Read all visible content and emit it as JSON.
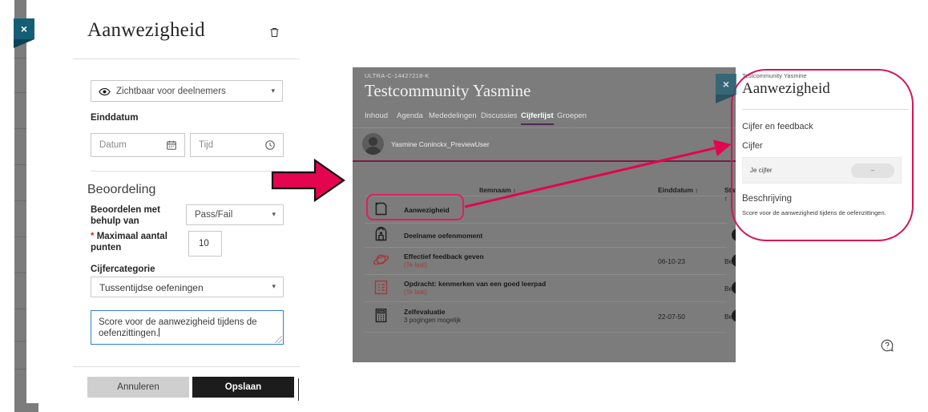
{
  "left_panel": {
    "title": "Aanwezigheid",
    "close_label": "×",
    "delete_icon": "trash-icon",
    "visibility": {
      "icon": "eye-icon",
      "value": "Zichtbaar voor deelnemers",
      "caret": "▾"
    },
    "einddatum": {
      "label": "Einddatum",
      "date_placeholder": "Datum",
      "date_icon": "calendar-icon",
      "time_placeholder": "Tijd",
      "time_icon": "clock-icon"
    },
    "beoordeling": {
      "heading": "Beoordeling",
      "grade_with_label": "Beoordelen met behulp van",
      "grade_with_value": "Pass/Fail",
      "maxpoints_star": "*",
      "maxpoints_label": "Maximaal aantal punten",
      "maxpoints_value": "10",
      "category_label": "Cijfercategorie",
      "category_value": "Tussentijdse oefeningen",
      "description_value": "Score voor de aanwezigheid tijdens de oefenzittingen."
    },
    "footer": {
      "cancel_label": "Annuleren",
      "save_label": "Opslaan"
    }
  },
  "middle_panel": {
    "course_id": "ULTRA-C-14427218-K",
    "course_title": "Testcommunity Yasmine",
    "close_label": "×",
    "tabs": [
      {
        "label": "Inhoud",
        "active": false
      },
      {
        "label": "Agenda",
        "active": false
      },
      {
        "label": "Mededelingen",
        "active": false
      },
      {
        "label": "Discussies",
        "active": false
      },
      {
        "label": "Cijferlijst",
        "active": true
      },
      {
        "label": "Groepen",
        "active": false
      }
    ],
    "user_name": "Yasmine Coninckx_PreviewUser",
    "columns": [
      {
        "label": "Itemnaam",
        "sort": "≡"
      },
      {
        "label": "Einddatum",
        "sort": "≡"
      },
      {
        "label": "Status",
        "sort": "≡"
      }
    ],
    "rows": [
      {
        "icon": "document-icon",
        "name": "Aanwezigheid",
        "sub": "",
        "date": "",
        "status": "",
        "has_pill": false
      },
      {
        "icon": "backpack-icon",
        "name": "Deelname oefenmoment",
        "sub": "",
        "date": "",
        "status": "",
        "has_pill": true
      },
      {
        "icon": "planet-icon",
        "name": "Effectief feedback geven",
        "sub": "(Te laat)",
        "date": "06-10-23",
        "status": "Beoordeeld",
        "has_pill": true
      },
      {
        "icon": "checklist-icon",
        "name": "Opdracht: kenmerken van een goed leerpad",
        "sub": "(Te laat)",
        "date": "",
        "status": "Beoordeeld",
        "has_pill": true
      },
      {
        "icon": "calculator-icon",
        "name": "Zelfevaluatie",
        "sub": "3 pogingen mogelijk",
        "date": "22-07-50",
        "status": "Beoordeeld",
        "has_pill": true
      }
    ]
  },
  "right_panel": {
    "course_title": "Testcommunity Yasmine",
    "title": "Aanwezigheid",
    "close_label": "×",
    "section_grade_feedback": "Cijfer en feedback",
    "section_grade": "Cijfer",
    "grade_box_label": "Je cijfer",
    "grade_box_value": "–",
    "section_description": "Beschrijving",
    "description": "Score voor de aanwezigheid tijdens de oefenzittingen.",
    "help_icon": "help-icon"
  },
  "annotations": {
    "big_arrow": "right-arrow",
    "connector_arrow": "callout-arrow",
    "row_highlight": "highlight-rect",
    "panel_highlight": "highlight-oval"
  },
  "colors": {
    "accent_pink": "#d4145a",
    "highlight_pink": "#e31c5f",
    "close_teal": "#135e75",
    "tab_underline": "#4e2a54",
    "user_underline": "#7a1d45",
    "save_bg": "#1c1c1c",
    "cancel_bg": "#cfcfcf",
    "dim_overlay": "#7c7c7c"
  }
}
